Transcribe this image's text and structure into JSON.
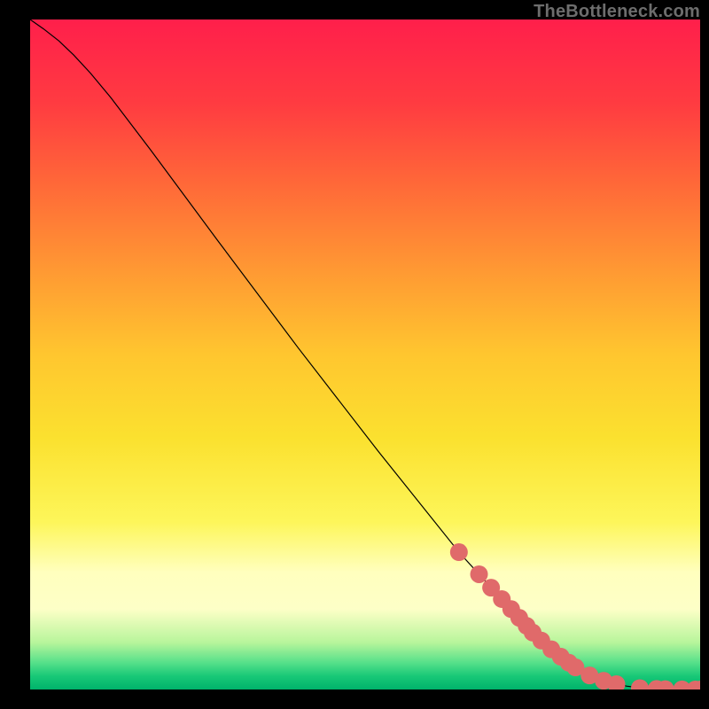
{
  "attribution": "TheBottleneck.com",
  "chart_data": {
    "type": "line",
    "title": "",
    "xlabel": "",
    "ylabel": "",
    "xlim": [
      0,
      100
    ],
    "ylim": [
      0,
      100
    ],
    "background_gradient": {
      "stops": [
        {
          "t": 0.0,
          "color": "#ff1f4b"
        },
        {
          "t": 0.125,
          "color": "#ff3b41"
        },
        {
          "t": 0.25,
          "color": "#ff6a38"
        },
        {
          "t": 0.375,
          "color": "#ff9933"
        },
        {
          "t": 0.5,
          "color": "#ffc62f"
        },
        {
          "t": 0.625,
          "color": "#fbe12f"
        },
        {
          "t": 0.75,
          "color": "#fdf65a"
        },
        {
          "t": 0.825,
          "color": "#ffffbe"
        },
        {
          "t": 0.88,
          "color": "#fdffc7"
        },
        {
          "t": 0.93,
          "color": "#b7f59b"
        },
        {
          "t": 0.96,
          "color": "#56e08a"
        },
        {
          "t": 0.98,
          "color": "#18c877"
        },
        {
          "t": 1.0,
          "color": "#00b36b"
        }
      ]
    },
    "series": [
      {
        "name": "curve",
        "type": "line",
        "stroke": "#000000",
        "stroke_width": 1.2,
        "x": [
          0.0,
          2.0,
          4.3,
          6.5,
          9.0,
          12.0,
          18.0,
          28.0,
          40.0,
          52.0,
          64.0,
          76.0,
          84.0,
          89.0,
          92.0,
          95.0,
          98.0,
          100.0
        ],
        "y": [
          100.0,
          98.6,
          96.8,
          94.7,
          92.0,
          88.4,
          80.5,
          67.0,
          51.0,
          35.5,
          20.5,
          7.3,
          1.9,
          0.5,
          0.15,
          0.05,
          0.01,
          0.0
        ]
      },
      {
        "name": "markers",
        "type": "scatter",
        "color": "#e06a6a",
        "radius": 10,
        "x": [
          64.0,
          67.0,
          68.8,
          70.4,
          71.8,
          73.0,
          74.1,
          75.0,
          76.3,
          77.8,
          79.2,
          80.4,
          81.4,
          83.5,
          85.6,
          87.5,
          91.0,
          93.5,
          94.8,
          97.3,
          99.3,
          100.0
        ],
        "y": [
          20.5,
          17.2,
          15.2,
          13.5,
          12.0,
          10.7,
          9.5,
          8.5,
          7.3,
          6.0,
          4.9,
          4.0,
          3.3,
          2.1,
          1.3,
          0.8,
          0.2,
          0.08,
          0.05,
          0.02,
          0.005,
          0.0
        ]
      }
    ]
  }
}
